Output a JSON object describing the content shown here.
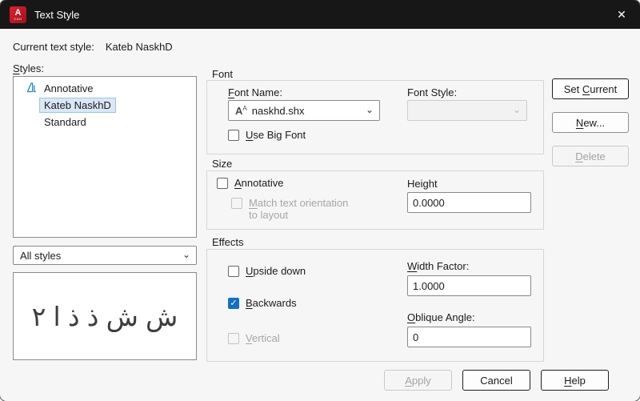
{
  "window": {
    "title": "Text Style",
    "logo_letter": "A",
    "logo_sub": "CAD"
  },
  "icons": {
    "close": "✕",
    "chevron": "⌄",
    "check": "✓",
    "shx_big": "A",
    "shx_small": "A"
  },
  "header": {
    "current_style_label": "Current text style:",
    "current_style_value": "Kateb NaskhD"
  },
  "styles_panel": {
    "label": "Styles:",
    "items": [
      {
        "label": "Annotative",
        "annotative": true,
        "selected": false
      },
      {
        "label": "Kateb NaskhD",
        "annotative": false,
        "selected": true
      },
      {
        "label": "Standard",
        "annotative": false,
        "selected": false
      }
    ],
    "filter_value": "All styles",
    "preview_text": "ش ش ذ ذ ا ٢"
  },
  "font_group": {
    "title": "Font",
    "font_name_label": "Font Name:",
    "font_name_value": "naskhd.shx",
    "font_style_label": "Font Style:",
    "font_style_value": "",
    "font_style_disabled": true,
    "use_big_font_label": "Use Big Font",
    "use_big_font_checked": false
  },
  "size_group": {
    "title": "Size",
    "annotative_label": "Annotative",
    "annotative_checked": false,
    "match_label_line1": "Match text orientation",
    "match_label_line2": "to layout",
    "match_disabled": true,
    "height_label": "Height",
    "height_value": "0.0000"
  },
  "effects_group": {
    "title": "Effects",
    "upside_down_label": "Upside down",
    "upside_down_checked": false,
    "backwards_label": "Backwards",
    "backwards_checked": true,
    "vertical_label": "Vertical",
    "vertical_checked": false,
    "vertical_disabled": true,
    "width_factor_label": "Width Factor:",
    "width_factor_value": "1.0000",
    "oblique_angle_label": "Oblique Angle:",
    "oblique_angle_value": "0"
  },
  "buttons": {
    "set_current": "Set Current",
    "new": "New...",
    "delete": "Delete",
    "delete_disabled": true,
    "apply": "Apply",
    "apply_disabled": true,
    "cancel": "Cancel",
    "help": "Help"
  }
}
